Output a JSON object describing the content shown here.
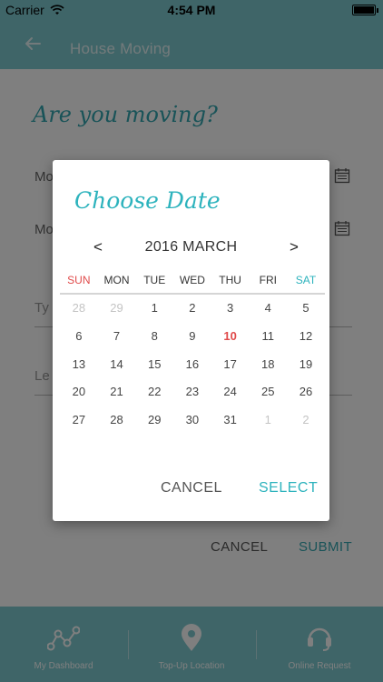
{
  "status_bar": {
    "carrier": "Carrier",
    "time": "4:54 PM"
  },
  "nav": {
    "title": "House Moving",
    "back_icon": "arrow-left-icon"
  },
  "form": {
    "question": "Are you moving?",
    "field_1_label": "Mo",
    "field_2_label": "Mo",
    "input_1_placeholder": "Ty",
    "input_2_placeholder": "Le",
    "cancel_label": "CANCEL",
    "submit_label": "SUBMIT"
  },
  "tabs": [
    {
      "label": "My Dashboard",
      "icon": "nodes-icon"
    },
    {
      "label": "Top-Up Location",
      "icon": "location-pin-icon"
    },
    {
      "label": "Online Request",
      "icon": "headset-icon"
    }
  ],
  "date_dialog": {
    "title": "Choose Date",
    "prev": "<",
    "next": ">",
    "month_label": "2016 MARCH",
    "weekdays": [
      "SUN",
      "MON",
      "TUE",
      "WED",
      "THU",
      "FRI",
      "SAT"
    ],
    "weeks": [
      [
        "28",
        "29",
        "1",
        "2",
        "3",
        "4",
        "5"
      ],
      [
        "6",
        "7",
        "8",
        "9",
        "10",
        "11",
        "12"
      ],
      [
        "13",
        "14",
        "15",
        "16",
        "17",
        "18",
        "19"
      ],
      [
        "20",
        "21",
        "22",
        "23",
        "24",
        "25",
        "26"
      ],
      [
        "27",
        "28",
        "29",
        "30",
        "31",
        "1",
        "2"
      ]
    ],
    "today": "10",
    "cancel_label": "CANCEL",
    "select_label": "SELECT"
  },
  "colors": {
    "teal_bar": "#7ecbd1",
    "accent": "#2db3bd",
    "sunday": "#e04a4a",
    "today": "#e04a4a",
    "overlay": "rgba(0,0,0,0.5)"
  }
}
